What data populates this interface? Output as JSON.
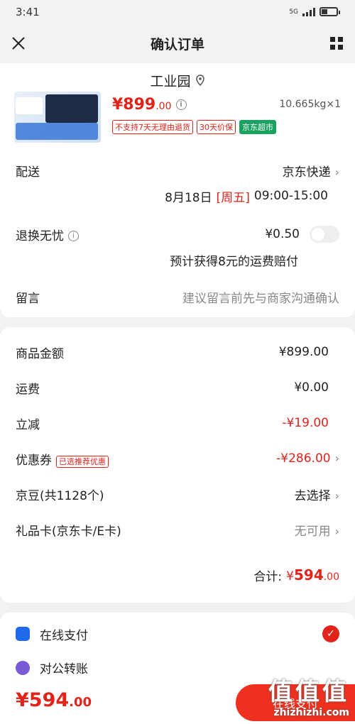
{
  "status": {
    "time": "3:41",
    "network": "5G"
  },
  "nav": {
    "title": "确认订单",
    "close_icon": "close-icon",
    "menu_icon": "grid-icon"
  },
  "address": {
    "text": "工业园"
  },
  "product": {
    "price_main": "¥899",
    "price_decimal": ".00",
    "weight": "10.665kg×1",
    "tags": [
      "不支持7天无理由退货",
      "30天价保",
      "京东超市"
    ]
  },
  "delivery": {
    "label": "配送",
    "value": "京东快递",
    "date": "8月18日",
    "weekday": "[周五]",
    "time": "09:00-15:00"
  },
  "returns": {
    "label": "退换无忧",
    "price": "¥0.50",
    "note": "预计获得8元的运费赔付"
  },
  "message": {
    "label": "留言",
    "placeholder": "建议留言前先与商家沟通确认"
  },
  "summary": {
    "goods_label": "商品金额",
    "goods_value": "¥899.00",
    "shipping_label": "运费",
    "shipping_value": "¥0.00",
    "discount_label": "立减",
    "discount_value": "-¥19.00",
    "coupon_label": "优惠券",
    "coupon_tag": "已选推荐优惠",
    "coupon_value": "-¥286.00",
    "beans_label": "京豆(共1128个)",
    "beans_value": "去选择",
    "giftcard_label": "礼品卡(京东卡/E卡)",
    "giftcard_value": "无可用",
    "total_label": "合计:",
    "total_symbol": "¥",
    "total_main": "594",
    "total_decimal": ".00"
  },
  "payment": {
    "online_label": "在线支付",
    "corporate_label": "对公转账"
  },
  "bottom": {
    "price_main": "¥594",
    "price_decimal": ".00",
    "button": "在线支付"
  },
  "watermark": {
    "big": "值值值",
    "small": "zhizhizhi.com"
  }
}
